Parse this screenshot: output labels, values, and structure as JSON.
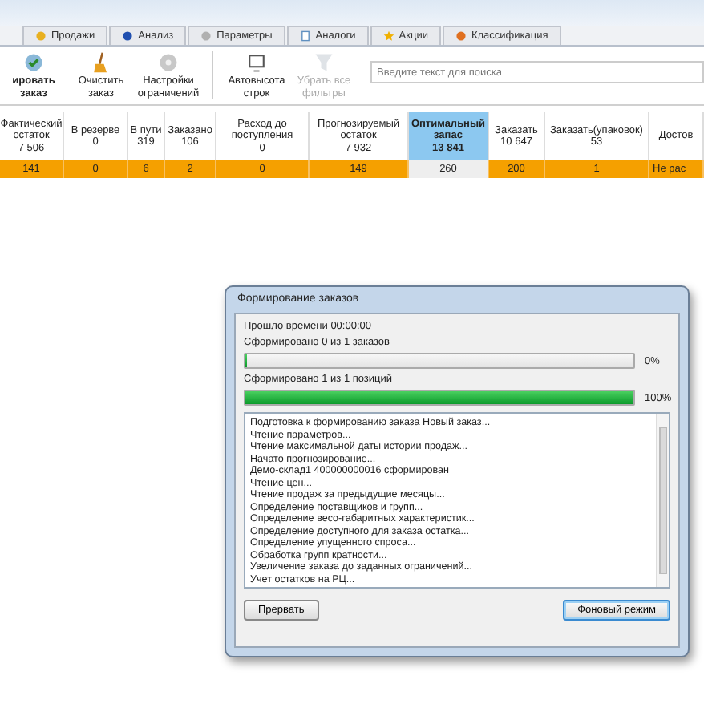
{
  "tabs": [
    {
      "label": "Продажи",
      "selected": false
    },
    {
      "label": "Анализ",
      "selected": false
    },
    {
      "label": "Параметры",
      "selected": false
    },
    {
      "label": "Аналоги",
      "selected": false
    },
    {
      "label": "Акции",
      "selected": false
    },
    {
      "label": "Классификация",
      "selected": false
    }
  ],
  "toolbar": [
    {
      "label": "ировать заказ",
      "disabled": false,
      "bold": true
    },
    {
      "label": "Очистить заказ",
      "disabled": false,
      "bold": false
    },
    {
      "label": "Настройки ограничений",
      "disabled": false,
      "bold": false
    },
    {
      "label": "Автовысота строк",
      "disabled": false,
      "bold": false
    },
    {
      "label": "Убрать все фильтры",
      "disabled": true,
      "bold": false
    }
  ],
  "search": {
    "placeholder": "Введите текст для поиска"
  },
  "table": {
    "columns": [
      {
        "label": "Фактический остаток",
        "total": "7 506",
        "selected": false
      },
      {
        "label": "В резерве",
        "total": "0",
        "selected": false
      },
      {
        "label": "В пути",
        "total": "319",
        "selected": false
      },
      {
        "label": "Заказано",
        "total": "106",
        "selected": false
      },
      {
        "label": "Расход до поступления",
        "total": "0",
        "selected": false
      },
      {
        "label": "Прогнозируемый остаток",
        "total": "7 932",
        "selected": false
      },
      {
        "label": "Оптимальный запас",
        "total": "13 841",
        "selected": true
      },
      {
        "label": "Заказать",
        "total": "10 647",
        "selected": false
      },
      {
        "label": "Заказать(упаковок)",
        "total": "53",
        "selected": false
      },
      {
        "label": "Достов",
        "selected": false
      }
    ],
    "rows": [
      {
        "cells": [
          "141",
          "0",
          "6",
          "2",
          "0",
          "149",
          "260",
          "200",
          "1",
          "Не рас"
        ]
      }
    ]
  },
  "dialog": {
    "title": "Формирование заказов",
    "elapsed": "Прошло времени 00:00:00",
    "progress": [
      {
        "label": "Сформировано 0 из 1 заказов",
        "level": 0,
        "reading": "0%"
      },
      {
        "label": "Сформировано 1 из 1 позиций",
        "level": 1,
        "reading": "100%"
      }
    ],
    "log": [
      "Подготовка к формированию заказа Новый заказ...",
      "Чтение параметров...",
      "Чтение максимальной даты истории продаж...",
      "Начато прогнозирование...",
      "Демо-склад1 400000000016 сформирован",
      "Чтение цен...",
      "Чтение продаж за предыдущие месяцы...",
      "Определение поставщиков и групп...",
      "Определение весо-габаритных характеристик...",
      "Определение доступного для заказа остатка...",
      "Определение упущенного спроса...",
      "Обработка групп кратности...",
      "Увеличение заказа до заданных ограничений...",
      "Учет остатков на РЦ..."
    ],
    "buttons": [
      {
        "label": "Прервать",
        "default": false
      },
      {
        "label": "Фоновый режим",
        "default": true
      }
    ]
  }
}
